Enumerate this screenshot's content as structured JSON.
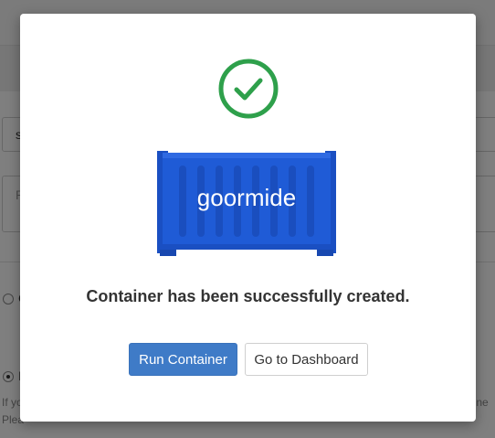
{
  "modal": {
    "message": "Container has been successfully created.",
    "illustration_brand": "goormide",
    "buttons": {
      "run_container": "Run Container",
      "go_to_dashboard": "Go to Dashboard"
    },
    "colors": {
      "success_green": "#2ea04b",
      "container_blue": "#1f5bd6",
      "primary_button": "#3f7bc7"
    },
    "icons": {
      "success": "check-circle-icon"
    }
  },
  "background": {
    "input_value": "s",
    "textarea_placeholder": "P",
    "radio_1_label": "C",
    "radio_2_label": "I",
    "note_line_1": "If yo",
    "note_line_1_end": "ione",
    "note_line_2": "Plea"
  }
}
